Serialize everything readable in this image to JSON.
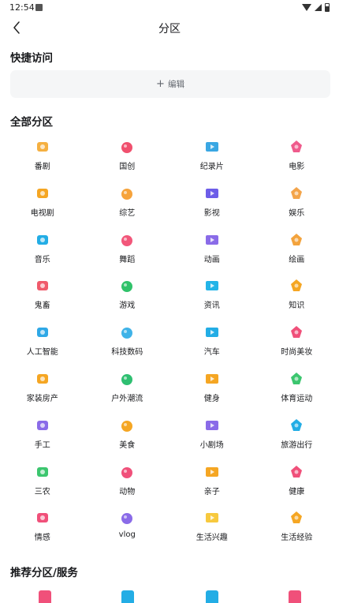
{
  "status_bar": {
    "time": "12:54"
  },
  "header": {
    "title": "分区",
    "back_icon": "chevron-left-icon"
  },
  "quick_access": {
    "title": "快捷访问",
    "edit_label": "编辑",
    "edit_icon": "plus-icon"
  },
  "all_sections": {
    "title": "全部分区",
    "items": [
      {
        "label": "番剧",
        "icon": "tv-bangumi-icon",
        "color": "#f5b041"
      },
      {
        "label": "国创",
        "icon": "guochuang-icon",
        "color": "#f0506e"
      },
      {
        "label": "纪录片",
        "icon": "whale-icon",
        "color": "#3aa7e3"
      },
      {
        "label": "电影",
        "icon": "3d-glasses-icon",
        "color": "#ef5b8c"
      },
      {
        "label": "电视剧",
        "icon": "tv-drama-icon",
        "color": "#f5a623"
      },
      {
        "label": "综艺",
        "icon": "microphone-icon",
        "color": "#f6a33b"
      },
      {
        "label": "影视",
        "icon": "film-screen-icon",
        "color": "#6d5de8"
      },
      {
        "label": "娱乐",
        "icon": "magic-wand-icon",
        "color": "#f3a44a"
      },
      {
        "label": "音乐",
        "icon": "headphones-icon",
        "color": "#23ade5"
      },
      {
        "label": "舞蹈",
        "icon": "fan-icon",
        "color": "#f2577a"
      },
      {
        "label": "动画",
        "icon": "play-screen-icon",
        "color": "#8a6be8"
      },
      {
        "label": "绘画",
        "icon": "palette-icon",
        "color": "#f3a33d"
      },
      {
        "label": "鬼畜",
        "icon": "monkey-icon",
        "color": "#f05a6b"
      },
      {
        "label": "游戏",
        "icon": "creeper-icon",
        "color": "#30c26a"
      },
      {
        "label": "资讯",
        "icon": "newspaper-icon",
        "color": "#23b4e8"
      },
      {
        "label": "知识",
        "icon": "lightbulb-question-icon",
        "color": "#f5a623"
      },
      {
        "label": "人工智能",
        "icon": "ai-icon",
        "color": "#2fa8e6"
      },
      {
        "label": "科技数码",
        "icon": "satellite-dome-icon",
        "color": "#3fb3e8"
      },
      {
        "label": "汽车",
        "icon": "car-icon",
        "color": "#23ade5"
      },
      {
        "label": "时尚美妆",
        "icon": "dress-icon",
        "color": "#f0507a"
      },
      {
        "label": "家装房产",
        "icon": "building-icon",
        "color": "#f5a623"
      },
      {
        "label": "户外潮流",
        "icon": "mountain-icon",
        "color": "#2fbf71"
      },
      {
        "label": "健身",
        "icon": "dumbbell-icon",
        "color": "#f5a623"
      },
      {
        "label": "体育运动",
        "icon": "runner-icon",
        "color": "#3cc66f"
      },
      {
        "label": "手工",
        "icon": "scissors-icon",
        "color": "#8a6be8"
      },
      {
        "label": "美食",
        "icon": "food-dome-icon",
        "color": "#f5a623"
      },
      {
        "label": "小剧场",
        "icon": "theater-stage-icon",
        "color": "#8a6be8"
      },
      {
        "label": "旅游出行",
        "icon": "suitcase-icon",
        "color": "#23ade5"
      },
      {
        "label": "三农",
        "icon": "sprout-icon",
        "color": "#3cc66f"
      },
      {
        "label": "动物",
        "icon": "paw-icon",
        "color": "#f0507a"
      },
      {
        "label": "亲子",
        "icon": "rocking-horse-icon",
        "color": "#f5a623"
      },
      {
        "label": "健康",
        "icon": "medical-kit-icon",
        "color": "#f0507a"
      },
      {
        "label": "情感",
        "icon": "heart-icon",
        "color": "#f0507a"
      },
      {
        "label": "vlog",
        "icon": "vlog-camera-icon",
        "color": "#8a6be8"
      },
      {
        "label": "生活兴趣",
        "icon": "rubber-duck-icon",
        "color": "#f7c93e"
      },
      {
        "label": "生活经验",
        "icon": "wrench-icon",
        "color": "#f5a623"
      }
    ]
  },
  "recommended": {
    "title": "推荐分区/服务",
    "icons": [
      {
        "icon": "recommend-1-icon",
        "color": "#f0507a"
      },
      {
        "icon": "recommend-2-icon",
        "color": "#23ade5"
      },
      {
        "icon": "recommend-3-icon",
        "color": "#23ade5"
      },
      {
        "icon": "recommend-4-icon",
        "color": "#f0507a"
      }
    ]
  }
}
